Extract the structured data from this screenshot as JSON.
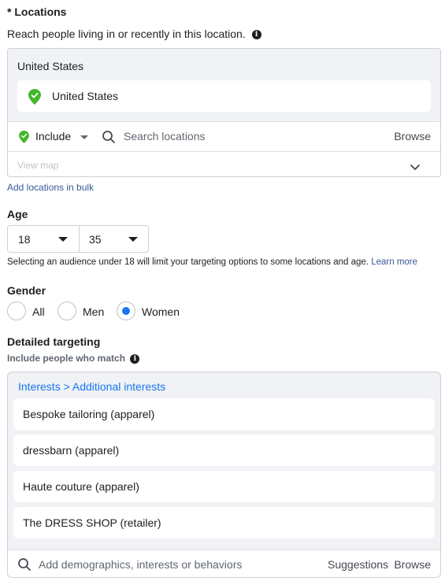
{
  "locations": {
    "title": "* Locations",
    "description": "Reach people living in or recently in this location.",
    "header": "United States",
    "selected": "United States",
    "include_label": "Include",
    "search_placeholder": "Search locations",
    "browse_label": "Browse",
    "view_map": "View map",
    "bulk_link": "Add locations in bulk"
  },
  "age": {
    "title": "Age",
    "min": "18",
    "max": "35",
    "note": "Selecting an audience under 18 will limit your targeting options to some locations and age.",
    "learn_more": "Learn more"
  },
  "gender": {
    "title": "Gender",
    "options": [
      "All",
      "Men",
      "Women"
    ],
    "selected": "Women"
  },
  "detailed": {
    "title": "Detailed targeting",
    "subtitle": "Include people who match",
    "breadcrumb": "Interests > Additional interests",
    "interests": [
      "Bespoke tailoring (apparel)",
      "dressbarn (apparel)",
      "Haute couture (apparel)",
      "The DRESS SHOP (retailer)"
    ],
    "search_placeholder": "Add demographics, interests or behaviors",
    "suggestions_label": "Suggestions",
    "browse_label": "Browse"
  },
  "colors": {
    "accent": "#1877f2",
    "link": "#385898",
    "pin_green": "#42b72a"
  }
}
